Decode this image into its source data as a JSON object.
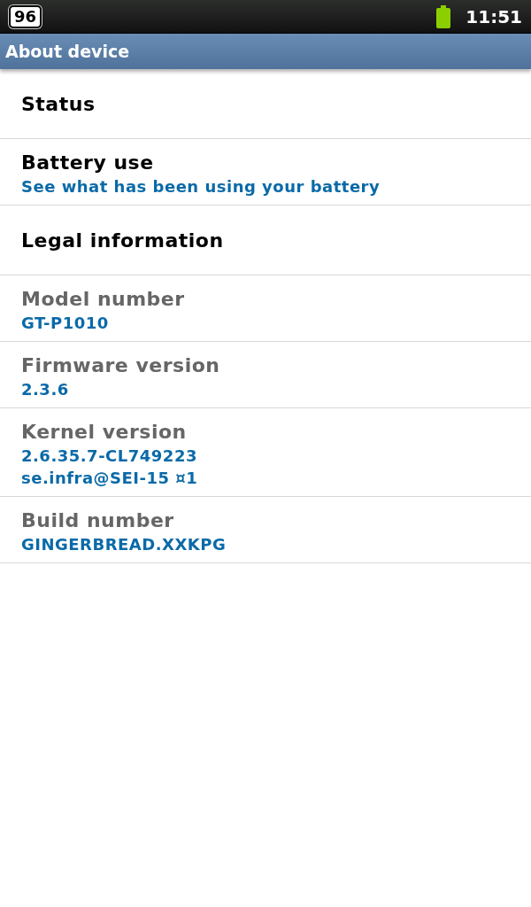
{
  "status_bar": {
    "badge": "96",
    "time": "11:51"
  },
  "title_bar": {
    "title": "About device"
  },
  "items": [
    {
      "kind": "link",
      "title": "Status"
    },
    {
      "kind": "link",
      "title": "Battery use",
      "lines": [
        "See what has been using your battery"
      ]
    },
    {
      "kind": "link",
      "title": "Legal information"
    },
    {
      "kind": "info",
      "title": "Model number",
      "lines": [
        "GT-P1010"
      ]
    },
    {
      "kind": "info",
      "title": "Firmware version",
      "lines": [
        "2.3.6"
      ]
    },
    {
      "kind": "info",
      "title": "Kernel version",
      "lines": [
        "2.6.35.7-CL749223",
        "se.infra@SEI-15 ¤1"
      ]
    },
    {
      "kind": "info",
      "title": "Build number",
      "lines": [
        "GINGERBREAD.XXKPG"
      ]
    }
  ]
}
